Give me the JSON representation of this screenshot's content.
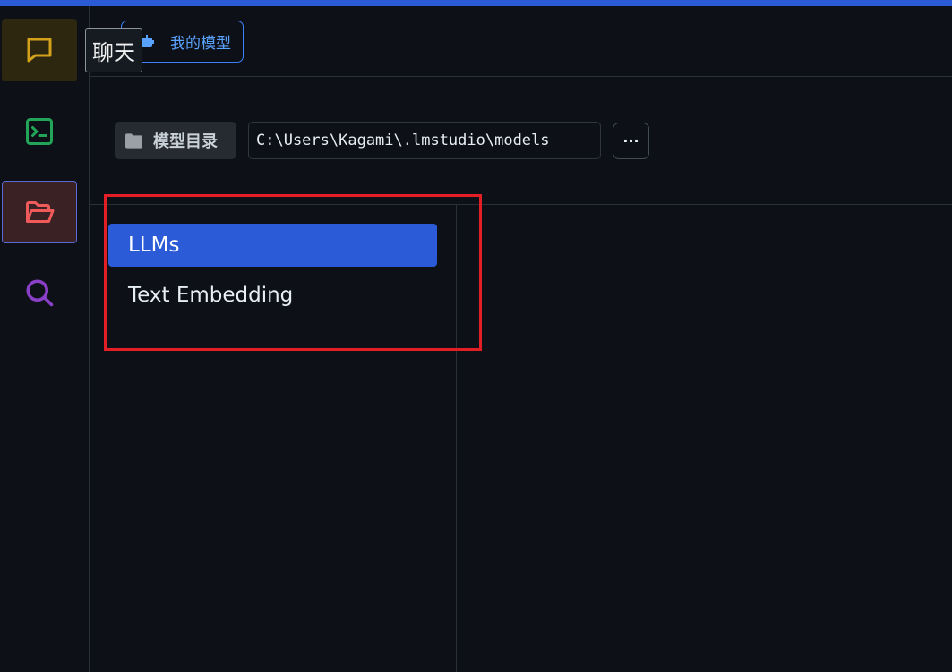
{
  "sidebar": {
    "items": [
      {
        "name": "chat",
        "icon": "message-square-icon",
        "color": "#d4a21a"
      },
      {
        "name": "terminal",
        "icon": "terminal-icon",
        "color": "#22a559"
      },
      {
        "name": "my-models",
        "icon": "folder-open-icon",
        "color": "#f05a5a"
      },
      {
        "name": "search",
        "icon": "search-icon",
        "color": "#8a3fc7"
      }
    ]
  },
  "tooltip": {
    "text": "聊天"
  },
  "header": {
    "tab_label": "我的模型",
    "tab_icon": "robot-icon"
  },
  "directory": {
    "label": "模型目录",
    "path": "C:\\Users\\Kagami\\.lmstudio\\models",
    "more_label": "···"
  },
  "categories": [
    {
      "label": "LLMs",
      "active": true
    },
    {
      "label": "Text Embedding",
      "active": false
    }
  ],
  "colors": {
    "accent": "#2b5bd7",
    "background": "#0d1117",
    "highlight": "#e31e24"
  }
}
